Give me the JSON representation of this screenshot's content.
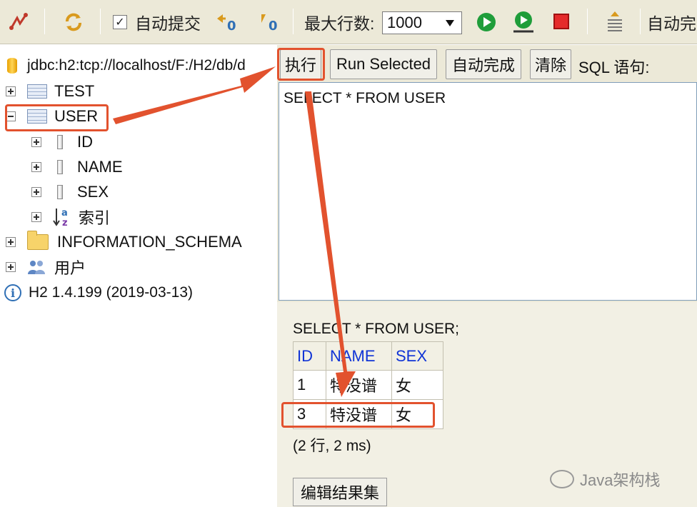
{
  "toolbar": {
    "autocommit_label": "自动提交",
    "maxrows_label": "最大行数:",
    "maxrows_value": "1000",
    "autocomplete_label": "自动完"
  },
  "tree": {
    "connection": "jdbc:h2:tcp://localhost/F:/H2/db/d",
    "tables": [
      {
        "name": "TEST",
        "expanded": false
      },
      {
        "name": "USER",
        "expanded": true,
        "columns": [
          "ID",
          "NAME",
          "SEX"
        ],
        "index_label": "索引"
      }
    ],
    "schema": "INFORMATION_SCHEMA",
    "users": "用户",
    "version": "H2 1.4.199 (2019-03-13)"
  },
  "buttons": {
    "execute": "执行",
    "run_selected": "Run Selected",
    "autocomplete": "自动完成",
    "clear": "清除",
    "sql_label": "SQL 语句:"
  },
  "editor": {
    "sql": "SELECT * FROM USER"
  },
  "result": {
    "query": "SELECT * FROM USER;",
    "columns": [
      "ID",
      "NAME",
      "SEX"
    ],
    "rows": [
      [
        "1",
        "特没谱",
        "女"
      ],
      [
        "3",
        "特没谱",
        "女"
      ]
    ],
    "summary": "(2 行, 2 ms)",
    "edit_button": "编辑结果集"
  },
  "watermark": "Java架构栈",
  "annotation_color": "#e2522e"
}
